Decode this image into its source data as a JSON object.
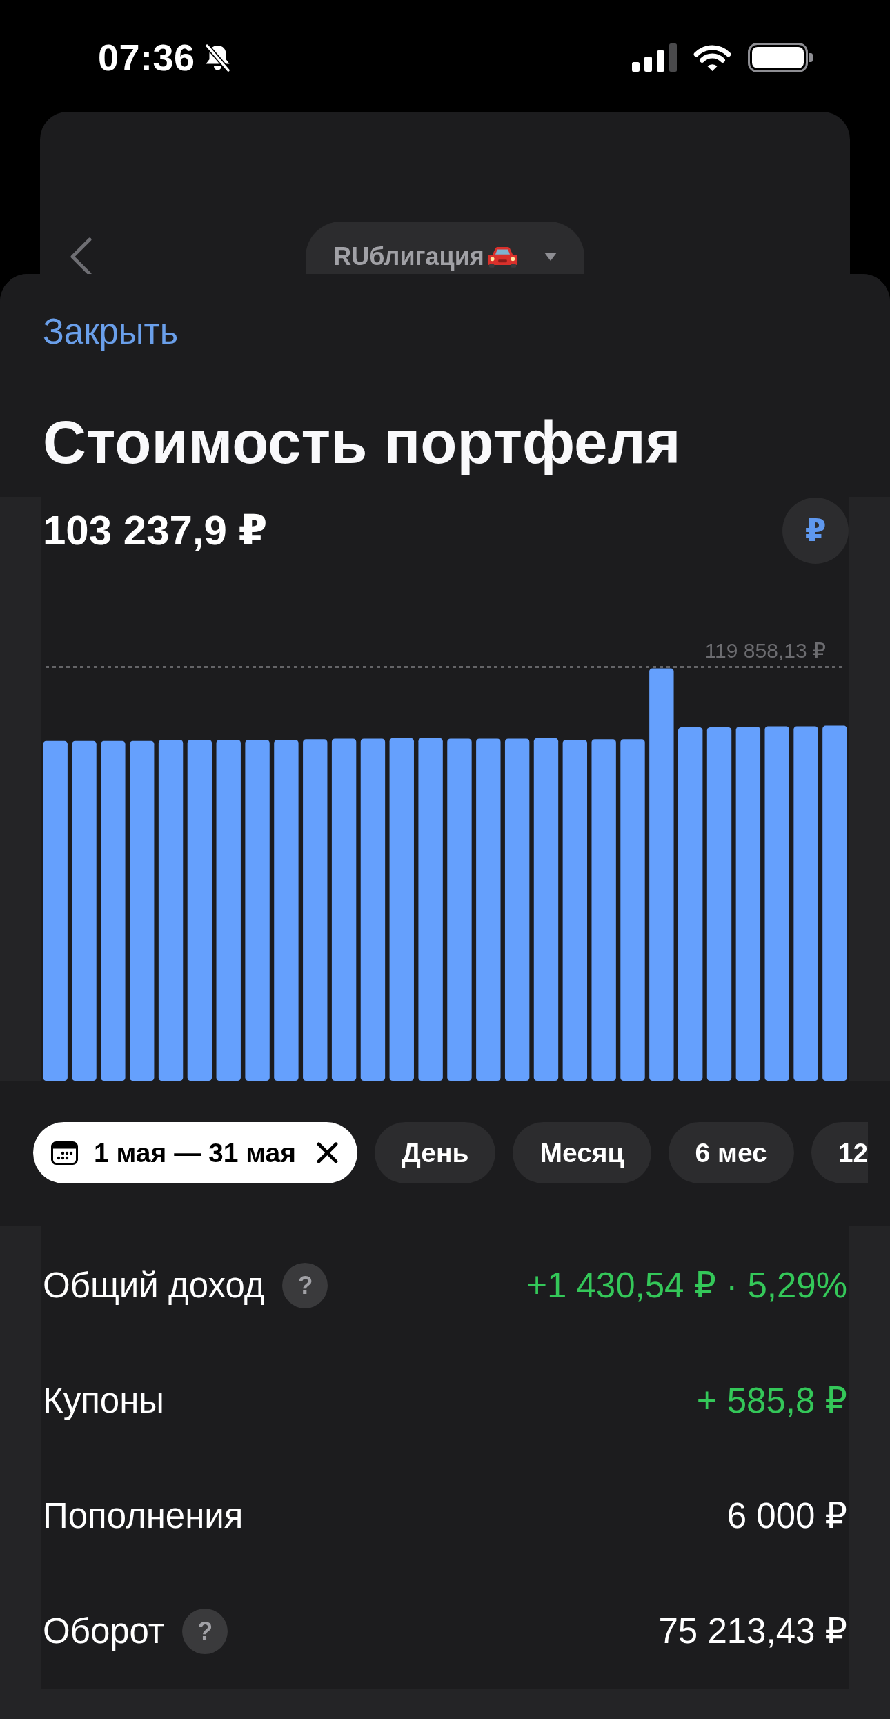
{
  "status_bar": {
    "time": "07:36"
  },
  "background_screen": {
    "portfolio_selector": {
      "label": "RUблигация"
    }
  },
  "sheet": {
    "close_link": "Закрыть",
    "title": "Стоимость портфеля",
    "value": "103 237,9 ₽",
    "currency_button": "₽",
    "chart": {
      "max_label": "119 858,13 ₽"
    },
    "periods": [
      {
        "kind": "range",
        "label": "1 мая — 31 мая",
        "selected": true
      },
      {
        "kind": "preset",
        "label": "День",
        "selected": false
      },
      {
        "kind": "preset",
        "label": "Месяц",
        "selected": false
      },
      {
        "kind": "preset",
        "label": "6 мес",
        "selected": false
      },
      {
        "kind": "preset",
        "label": "12",
        "selected": false
      }
    ],
    "stats": [
      {
        "label": "Общий доход",
        "help": "?",
        "value": "+1 430,54 ₽ · 5,29%",
        "positive": true
      },
      {
        "label": "Купоны",
        "value": "+ 585,8 ₽",
        "positive": true
      },
      {
        "label": "Пополнения",
        "value": "6 000 ₽",
        "positive": false
      },
      {
        "label": "Оборот",
        "help": "?",
        "value": "75 213,43 ₽",
        "positive": false
      }
    ]
  }
}
